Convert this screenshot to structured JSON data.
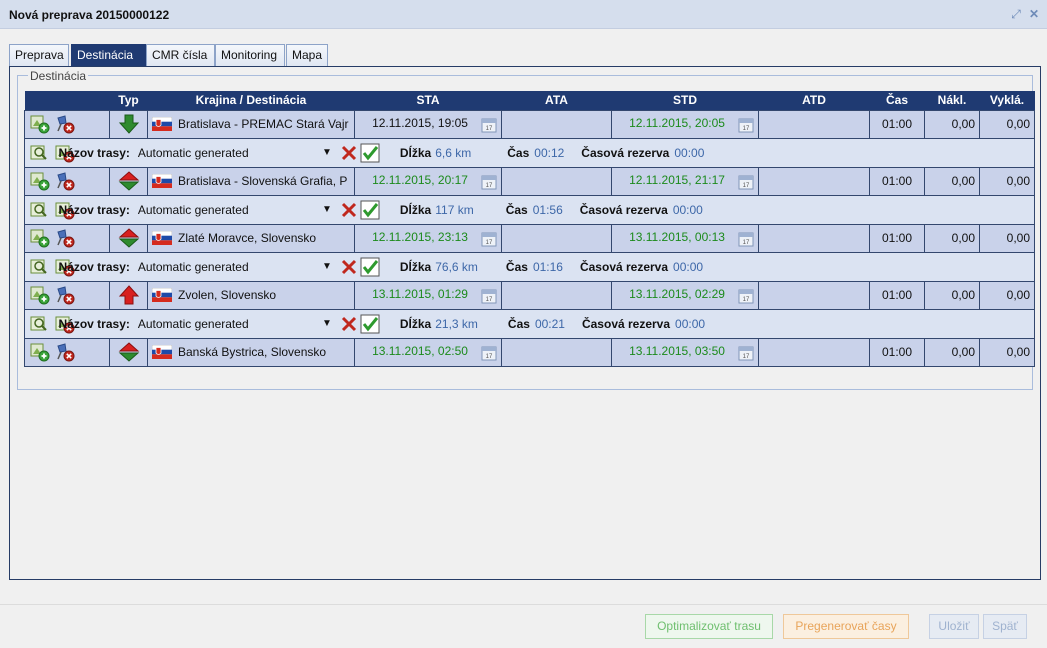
{
  "window": {
    "title": "Nová preprava 20150000122"
  },
  "tabs": [
    "Preprava",
    "Destinácia",
    "CMR čísla",
    "Monitoring",
    "Mapa"
  ],
  "active_tab": "Destinácia",
  "fieldset": {
    "legend": "Destinácia"
  },
  "columns": {
    "type": "Typ",
    "destination": "Krajina / Destinácia",
    "sta": "STA",
    "ata": "ATA",
    "std": "STD",
    "atd": "ATD",
    "time": "Čas",
    "load": "Nákl.",
    "unload": "Vyklá."
  },
  "destinations": [
    {
      "name": "Bratislava - PREMAC Stará Vajr",
      "sta": "12.11.2015, 19:05",
      "ata": "",
      "std": "12.11.2015, 20:05",
      "atd": "",
      "time": "01:00",
      "load": "0,00",
      "unload": "0,00",
      "type_icon": "unload-arrow-down-icon"
    },
    {
      "name": "Bratislava - Slovenská Grafia, P",
      "sta": "12.11.2015, 20:17",
      "ata": "",
      "std": "12.11.2015, 21:17",
      "atd": "",
      "time": "01:00",
      "load": "0,00",
      "unload": "0,00",
      "type_icon": "load-unload-icon"
    },
    {
      "name": "Zlaté Moravce, Slovensko",
      "sta": "12.11.2015, 23:13",
      "ata": "",
      "std": "13.11.2015, 00:13",
      "atd": "",
      "time": "01:00",
      "load": "0,00",
      "unload": "0,00",
      "type_icon": "load-unload-icon"
    },
    {
      "name": "Zvolen, Slovensko",
      "sta": "13.11.2015, 01:29",
      "ata": "",
      "std": "13.11.2015, 02:29",
      "atd": "",
      "time": "01:00",
      "load": "0,00",
      "unload": "0,00",
      "type_icon": "load-arrow-up-icon"
    },
    {
      "name": "Banská Bystrica, Slovensko",
      "sta": "13.11.2015, 02:50",
      "ata": "",
      "std": "13.11.2015, 03:50",
      "atd": "",
      "time": "01:00",
      "load": "0,00",
      "unload": "0,00",
      "type_icon": "load-unload-icon"
    }
  ],
  "routes": [
    {
      "name_label": "Názov trasy:",
      "name_value": "Automatic generated",
      "length_label": "Dĺžka",
      "length": "6,6 km",
      "time_label": "Čas",
      "time": "00:12",
      "reserve_label": "Časová rezerva",
      "reserve": "00:00"
    },
    {
      "name_label": "Názov trasy:",
      "name_value": "Automatic generated",
      "length_label": "Dĺžka",
      "length": "117 km",
      "time_label": "Čas",
      "time": "01:56",
      "reserve_label": "Časová rezerva",
      "reserve": "00:00"
    },
    {
      "name_label": "Názov trasy:",
      "name_value": "Automatic generated",
      "length_label": "Dĺžka",
      "length": "76,6 km",
      "time_label": "Čas",
      "time": "01:16",
      "reserve_label": "Časová rezerva",
      "reserve": "00:00"
    },
    {
      "name_label": "Názov trasy:",
      "name_value": "Automatic generated",
      "length_label": "Dĺžka",
      "length": "21,3 km",
      "time_label": "Čas",
      "time": "00:21",
      "reserve_label": "Časová rezerva",
      "reserve": "00:00"
    }
  ],
  "footer": {
    "optimize": "Optimalizovať trasu",
    "regenerate": "Pregenerovať časy",
    "save": "Uložiť",
    "back": "Späť"
  },
  "colors": {
    "header_bg": "#1f3a72",
    "row_bg": "#c9d2ea",
    "route_bg": "#dbe3f2",
    "green_text": "#1b8a1b",
    "blue_text": "#3d67a8"
  }
}
